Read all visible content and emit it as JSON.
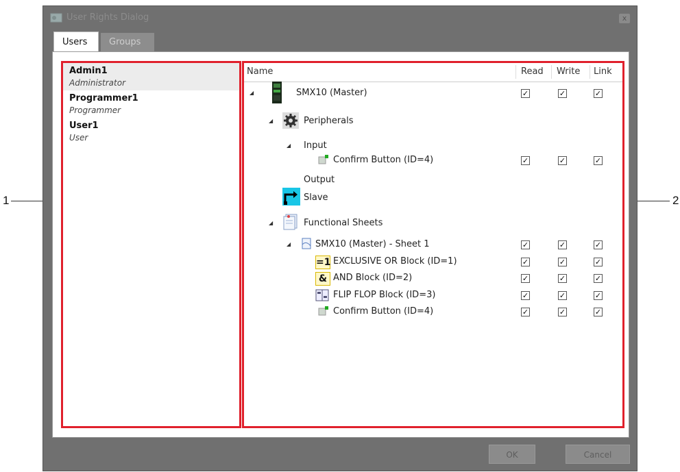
{
  "dialog": {
    "title": "User Rights Dialog",
    "close_label": "x"
  },
  "tabs": [
    {
      "label": "Users",
      "active": true
    },
    {
      "label": "Groups",
      "active": false
    }
  ],
  "callouts": [
    "1",
    "2"
  ],
  "users": [
    {
      "name": "Admin1",
      "role": "Administrator",
      "selected": true
    },
    {
      "name": "Programmer1",
      "role": "Programmer",
      "selected": false
    },
    {
      "name": "User1",
      "role": "User",
      "selected": false
    }
  ],
  "columns": {
    "name": "Name",
    "read": "Read",
    "write": "Write",
    "link": "Link"
  },
  "tree": [
    {
      "label": "SMX10 (Master)",
      "icon": "device-icon",
      "expander": "◢",
      "checks": [
        true,
        true,
        true
      ]
    },
    {
      "label": "Peripherals",
      "icon": "gear-icon",
      "expander": "◢",
      "checks": null
    },
    {
      "label": "Input",
      "icon": null,
      "expander": "◢",
      "checks": null
    },
    {
      "label": "Confirm Button (ID=4)",
      "icon": "input-button-icon",
      "expander": null,
      "checks": [
        true,
        true,
        true
      ]
    },
    {
      "label": "Output",
      "icon": null,
      "expander": null,
      "checks": null
    },
    {
      "label": "Slave",
      "icon": "slave-icon",
      "expander": null,
      "checks": null
    },
    {
      "label": "Functional Sheets",
      "icon": "sheets-icon",
      "expander": "◢",
      "checks": null
    },
    {
      "label": "SMX10 (Master) - Sheet 1",
      "icon": "sheet-icon",
      "expander": "◢",
      "checks": [
        true,
        true,
        true
      ]
    },
    {
      "label": "EXCLUSIVE OR Block (ID=1)",
      "icon": "xor-block-icon",
      "icon_text": "=1",
      "expander": null,
      "checks": [
        true,
        true,
        true
      ]
    },
    {
      "label": "AND Block (ID=2)",
      "icon": "and-block-icon",
      "icon_text": "&",
      "expander": null,
      "checks": [
        true,
        true,
        true
      ]
    },
    {
      "label": "FLIP FLOP Block (ID=3)",
      "icon": "flipflop-block-icon",
      "expander": null,
      "checks": [
        true,
        true,
        true
      ]
    },
    {
      "label": "Confirm Button (ID=4)",
      "icon": "input-button-icon",
      "expander": null,
      "checks": [
        true,
        true,
        true
      ]
    }
  ],
  "check_mark": "✓",
  "buttons": {
    "ok": "OK",
    "cancel": "Cancel"
  },
  "colors": {
    "highlight_border": "#e0202c",
    "dialog_bg": "#707070"
  }
}
